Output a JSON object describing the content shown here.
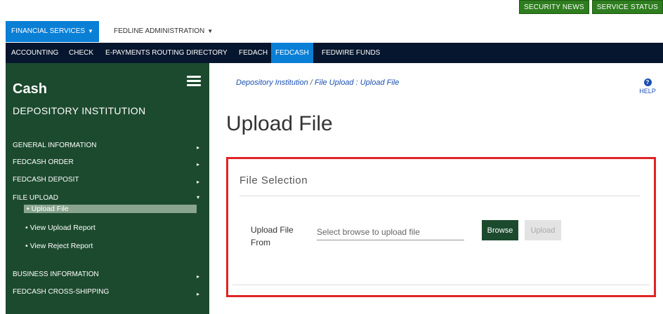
{
  "top_buttons": {
    "security_news": "SECURITY NEWS",
    "service_status": "SERVICE STATUS"
  },
  "nav_primary": {
    "financial_services": "FINANCIAL SERVICES",
    "fedline_admin": "FEDLINE ADMINISTRATION"
  },
  "nav_secondary": {
    "items": [
      "ACCOUNTING",
      "CHECK",
      "E-PAYMENTS ROUTING DIRECTORY",
      "FEDACH",
      "FEDCASH",
      "FEDWIRE FUNDS"
    ],
    "active": "FEDCASH"
  },
  "sidebar": {
    "title": "Cash",
    "subtitle": "DEPOSITORY INSTITUTION",
    "items": [
      {
        "label": "GENERAL INFORMATION",
        "arrow": "▸"
      },
      {
        "label": "FEDCASH ORDER",
        "arrow": "▸"
      },
      {
        "label": "FEDCASH DEPOSIT",
        "arrow": "▸"
      },
      {
        "label": "FILE UPLOAD",
        "arrow": "▾"
      },
      {
        "label": "BUSINESS INFORMATION",
        "arrow": "▸"
      },
      {
        "label": "FEDCASH CROSS-SHIPPING",
        "arrow": "▸"
      }
    ],
    "file_upload_subitems": [
      "Upload File",
      "View Upload Report",
      "View Reject Report"
    ],
    "bullet": "•",
    "active_subitem": "Upload File"
  },
  "breadcrumb": {
    "parent": "Depository Institution",
    "separator": "/",
    "current": "File Upload : Upload File"
  },
  "help": {
    "label": "HELP",
    "icon": "question-icon",
    "glyph": "?"
  },
  "page_title": "Upload File",
  "file_selection": {
    "header": "File Selection",
    "field_label": "Upload File From",
    "input_placeholder": "Select browse to upload file",
    "browse_label": "Browse",
    "upload_label": "Upload"
  },
  "colors": {
    "primary_nav_active": "#0a7fd6",
    "secondary_nav_bg": "#06162e",
    "sidebar_bg": "#1c4a2e",
    "top_button_bg": "#2e7d1f",
    "highlight_border": "#e02424"
  }
}
